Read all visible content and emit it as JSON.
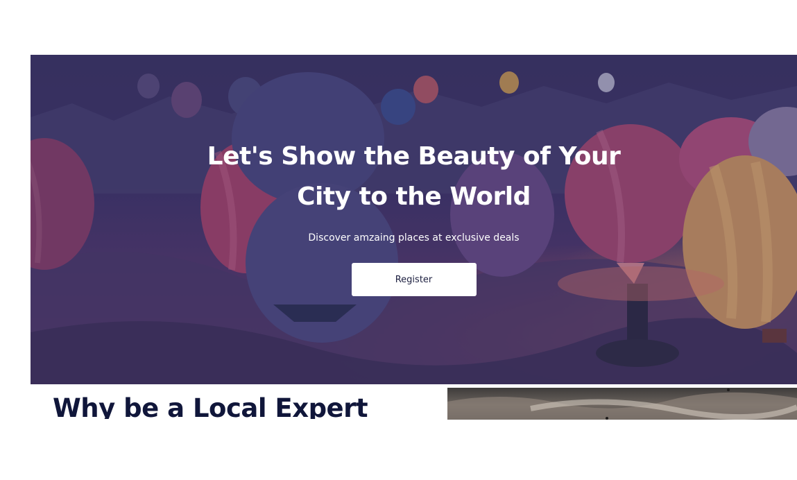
{
  "hero": {
    "title": "Let's Show the Beauty of Your City to the World",
    "subtitle": "Discover amzaing places at exclusive deals",
    "register_label": "Register",
    "background_image": "hot-air-balloons-over-valley"
  },
  "why_section": {
    "title": "Why be a Local Expert",
    "side_image": "cloudy-sky-photo"
  },
  "colors": {
    "overlay": "#2a2560",
    "heading_dark": "#10163a",
    "button_bg": "#ffffff",
    "button_text": "#1b1e3f"
  }
}
